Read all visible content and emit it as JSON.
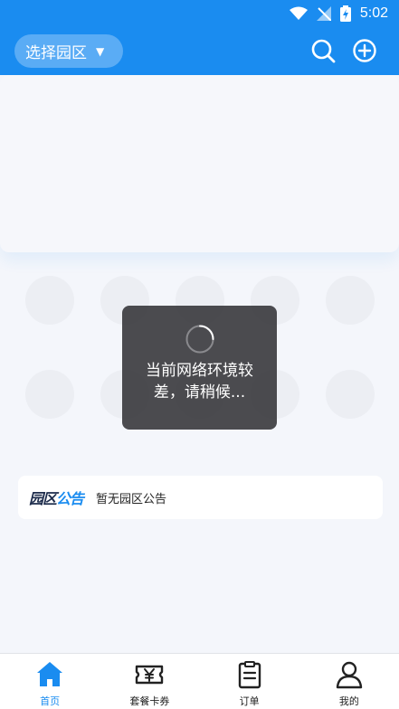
{
  "status_bar": {
    "time": "5:02"
  },
  "header": {
    "park_select_label": "选择园区",
    "park_select_caret": "▼",
    "search_icon": "search-icon",
    "add_icon": "add-circle-icon"
  },
  "toast": {
    "message": "当前网络环境较差，请稍候..."
  },
  "notice": {
    "logo_part1": "园区",
    "logo_part2": "公告",
    "text": "暂无园区公告"
  },
  "tabbar": {
    "tabs": [
      {
        "label": "首页",
        "icon": "home-icon",
        "active": true
      },
      {
        "label": "套餐卡券",
        "icon": "ticket-icon",
        "active": false
      },
      {
        "label": "订单",
        "icon": "clipboard-icon",
        "active": false
      },
      {
        "label": "我的",
        "icon": "user-icon",
        "active": false
      }
    ]
  },
  "colors": {
    "brand": "#1a8cf0",
    "background": "#f4f6fb",
    "toast_bg": "#3c3c40",
    "text_dark": "#222222"
  }
}
